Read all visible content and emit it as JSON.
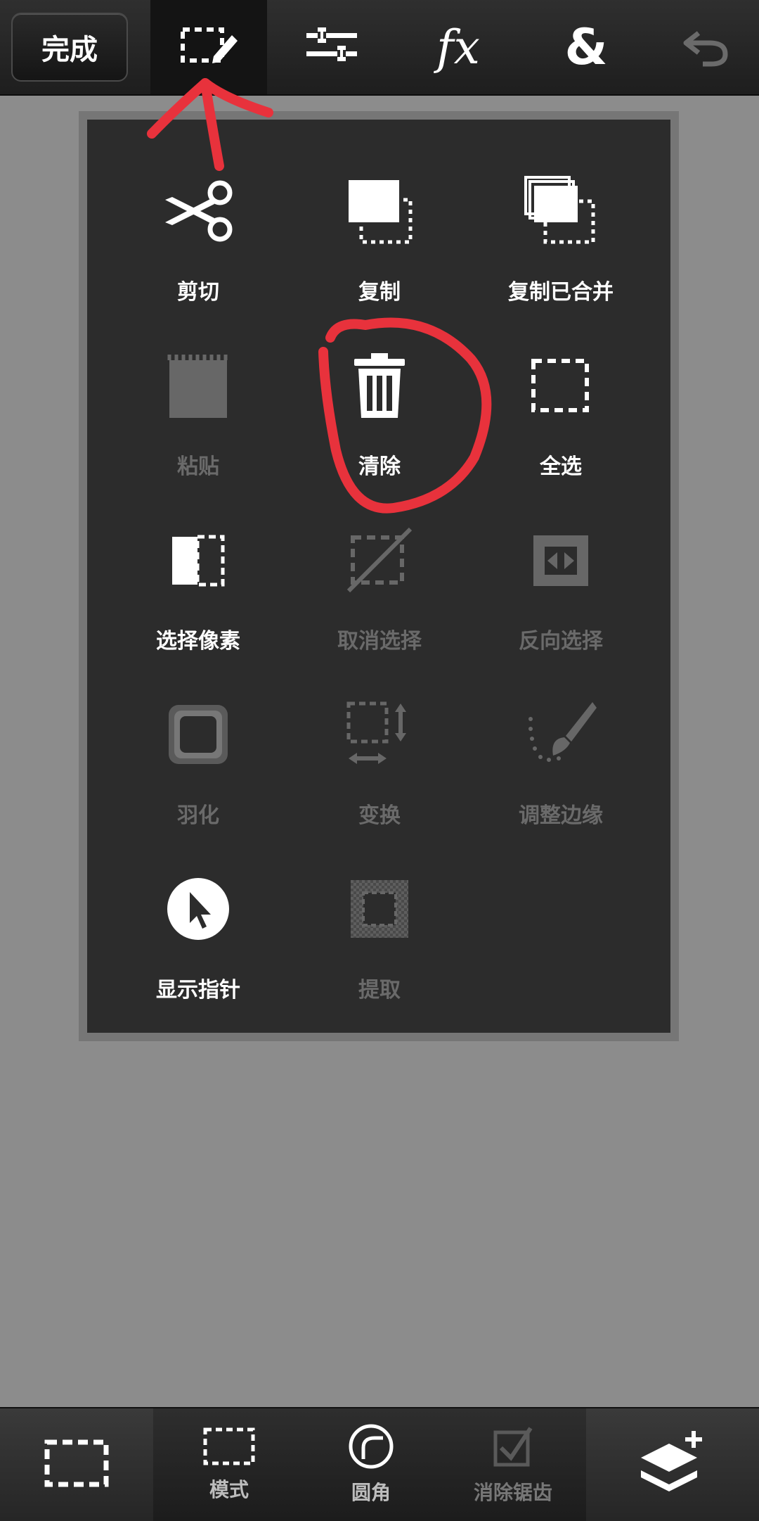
{
  "toolbar": {
    "done_label": "完成",
    "buttons": [
      {
        "name": "selection-edit-icon"
      },
      {
        "name": "adjust-sliders-icon"
      },
      {
        "name": "fx-icon",
        "text": "fx"
      },
      {
        "name": "blend-ampersand-icon",
        "text": "&"
      },
      {
        "name": "undo-icon"
      }
    ]
  },
  "menu": {
    "items": [
      {
        "label": "剪切",
        "icon": "scissors-icon",
        "enabled": true
      },
      {
        "label": "复制",
        "icon": "copy-icon",
        "enabled": true
      },
      {
        "label": "复制已合并",
        "icon": "copy-merged-icon",
        "enabled": true
      },
      {
        "label": "粘贴",
        "icon": "paste-icon",
        "enabled": false
      },
      {
        "label": "清除",
        "icon": "trash-icon",
        "enabled": true
      },
      {
        "label": "全选",
        "icon": "select-all-icon",
        "enabled": true
      },
      {
        "label": "选择像素",
        "icon": "select-pixels-icon",
        "enabled": true
      },
      {
        "label": "取消选择",
        "icon": "deselect-icon",
        "enabled": false
      },
      {
        "label": "反向选择",
        "icon": "invert-selection-icon",
        "enabled": false
      },
      {
        "label": "羽化",
        "icon": "feather-icon",
        "enabled": false
      },
      {
        "label": "变换",
        "icon": "transform-icon",
        "enabled": false
      },
      {
        "label": "调整边缘",
        "icon": "refine-edge-brush-icon",
        "enabled": false
      },
      {
        "label": "显示指针",
        "icon": "show-pointer-icon",
        "enabled": true
      },
      {
        "label": "提取",
        "icon": "extract-icon",
        "enabled": false
      }
    ]
  },
  "bottom": {
    "items": [
      {
        "label": "模式",
        "icon": "mode-icon",
        "enabled": true
      },
      {
        "label": "圆角",
        "icon": "rounded-corner-icon",
        "enabled": true
      },
      {
        "label": "消除锯齿",
        "icon": "antialias-icon",
        "enabled": false
      }
    ]
  },
  "colors": {
    "annotation": "#e8323c",
    "panel_bg": "#2c2c2c",
    "canvas_bg": "#8c8c8c"
  }
}
